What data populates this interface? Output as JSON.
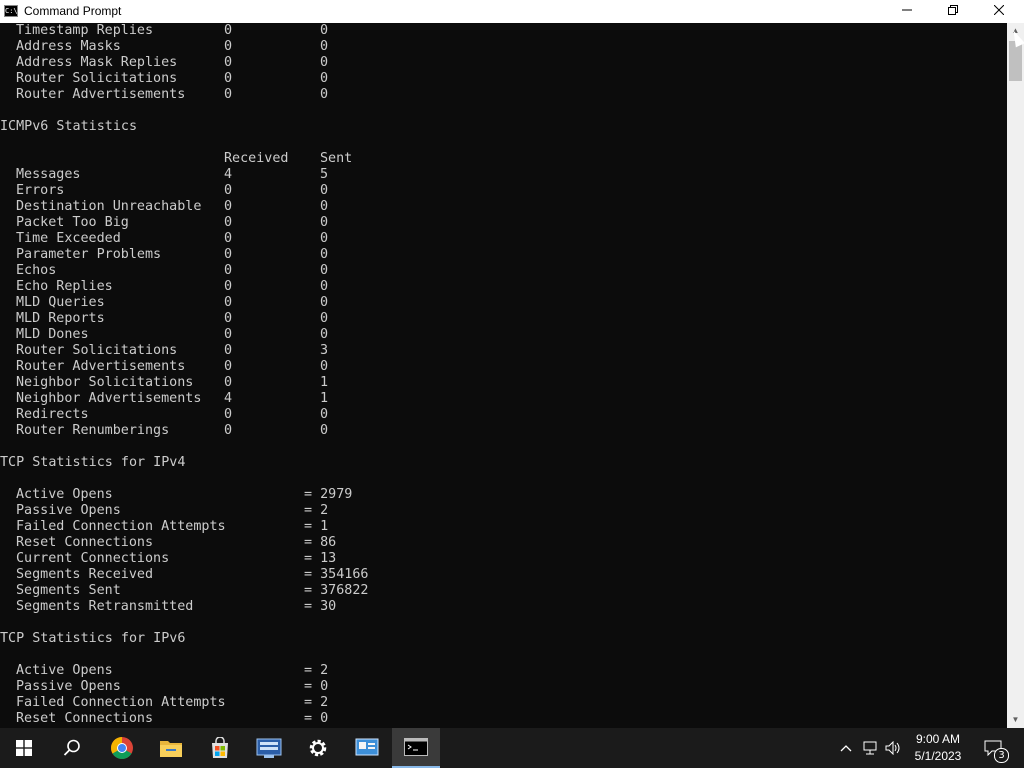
{
  "window": {
    "title": "Command Prompt",
    "minimize_icon": "minimize-icon",
    "maximize_icon": "restore-icon",
    "close_icon": "close-icon",
    "titlebar_bg": "#ffffff",
    "console_bg": "#0c0c0c",
    "console_fg": "#cccccc"
  },
  "console": {
    "icmpv4_tail": [
      {
        "label": "Timestamp Replies",
        "received": "0",
        "sent": "0"
      },
      {
        "label": "Address Masks",
        "received": "0",
        "sent": "0"
      },
      {
        "label": "Address Mask Replies",
        "received": "0",
        "sent": "0"
      },
      {
        "label": "Router Solicitations",
        "received": "0",
        "sent": "0"
      },
      {
        "label": "Router Advertisements",
        "received": "0",
        "sent": "0"
      }
    ],
    "icmpv6": {
      "heading": "ICMPv6 Statistics",
      "col_received": "Received",
      "col_sent": "Sent",
      "rows": [
        {
          "label": "Messages",
          "received": "4",
          "sent": "5"
        },
        {
          "label": "Errors",
          "received": "0",
          "sent": "0"
        },
        {
          "label": "Destination Unreachable",
          "received": "0",
          "sent": "0"
        },
        {
          "label": "Packet Too Big",
          "received": "0",
          "sent": "0"
        },
        {
          "label": "Time Exceeded",
          "received": "0",
          "sent": "0"
        },
        {
          "label": "Parameter Problems",
          "received": "0",
          "sent": "0"
        },
        {
          "label": "Echos",
          "received": "0",
          "sent": "0"
        },
        {
          "label": "Echo Replies",
          "received": "0",
          "sent": "0"
        },
        {
          "label": "MLD Queries",
          "received": "0",
          "sent": "0"
        },
        {
          "label": "MLD Reports",
          "received": "0",
          "sent": "0"
        },
        {
          "label": "MLD Dones",
          "received": "0",
          "sent": "0"
        },
        {
          "label": "Router Solicitations",
          "received": "0",
          "sent": "3"
        },
        {
          "label": "Router Advertisements",
          "received": "0",
          "sent": "0"
        },
        {
          "label": "Neighbor Solicitations",
          "received": "0",
          "sent": "1"
        },
        {
          "label": "Neighbor Advertisements",
          "received": "4",
          "sent": "1"
        },
        {
          "label": "Redirects",
          "received": "0",
          "sent": "0"
        },
        {
          "label": "Router Renumberings",
          "received": "0",
          "sent": "0"
        }
      ]
    },
    "tcp_ipv4": {
      "heading": "TCP Statistics for IPv4",
      "rows": [
        {
          "label": "Active Opens",
          "value": "= 2979"
        },
        {
          "label": "Passive Opens",
          "value": "= 2"
        },
        {
          "label": "Failed Connection Attempts",
          "value": "= 1"
        },
        {
          "label": "Reset Connections",
          "value": "= 86"
        },
        {
          "label": "Current Connections",
          "value": "= 13"
        },
        {
          "label": "Segments Received",
          "value": "= 354166"
        },
        {
          "label": "Segments Sent",
          "value": "= 376822"
        },
        {
          "label": "Segments Retransmitted",
          "value": "= 30"
        }
      ]
    },
    "tcp_ipv6": {
      "heading": "TCP Statistics for IPv6",
      "rows": [
        {
          "label": "Active Opens",
          "value": "= 2"
        },
        {
          "label": "Passive Opens",
          "value": "= 0"
        },
        {
          "label": "Failed Connection Attempts",
          "value": "= 2"
        },
        {
          "label": "Reset Connections",
          "value": "= 0"
        }
      ]
    }
  },
  "taskbar": {
    "items": [
      {
        "name": "start-button",
        "icon": "windows-logo-icon"
      },
      {
        "name": "search-button",
        "icon": "search-icon"
      },
      {
        "name": "chrome-button",
        "icon": "chrome-icon"
      },
      {
        "name": "file-explorer-button",
        "icon": "folder-icon"
      },
      {
        "name": "microsoft-store-button",
        "icon": "store-icon"
      },
      {
        "name": "server-manager-button",
        "icon": "server-manager-icon"
      },
      {
        "name": "settings-button",
        "icon": "gear-icon"
      },
      {
        "name": "control-panel-button",
        "icon": "control-panel-icon"
      },
      {
        "name": "command-prompt-taskbar-button",
        "icon": "command-prompt-icon",
        "active": true
      }
    ],
    "time": "9:00 AM",
    "date": "5/1/2023",
    "notification_count": "3",
    "accent": "#88b8e8"
  }
}
